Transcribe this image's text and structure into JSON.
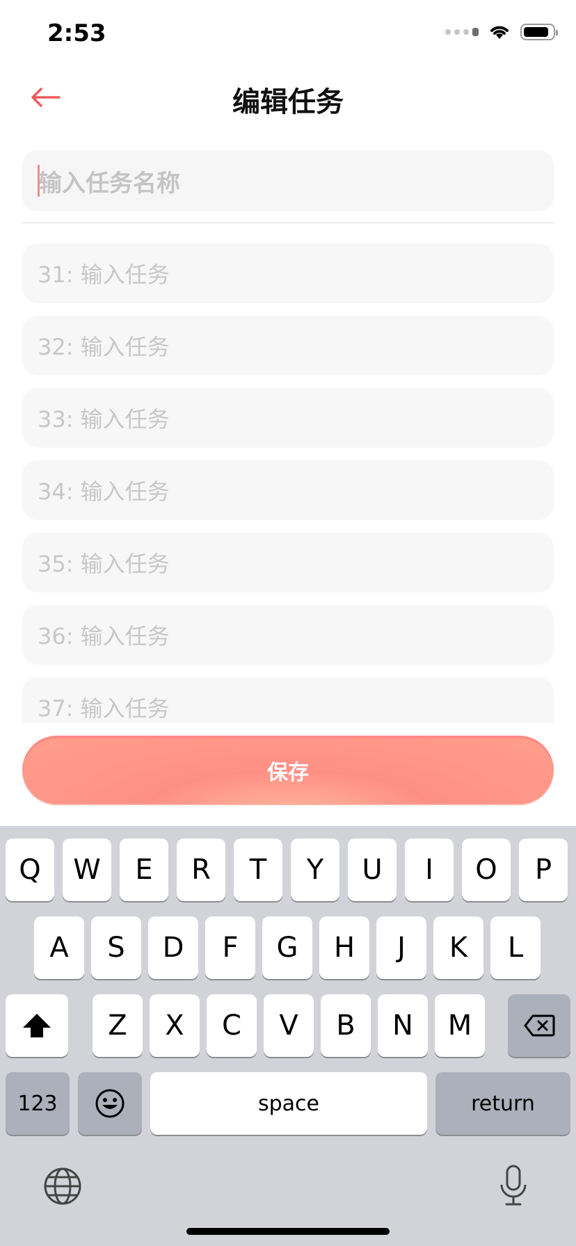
{
  "status": {
    "time": "2:53"
  },
  "nav": {
    "title": "编辑任务"
  },
  "colors": {
    "accent": "#ef5b5b",
    "save_button": "#ff8f86",
    "field_bg": "#f7f7f7",
    "placeholder": "#c7c7c7"
  },
  "name_field": {
    "placeholder": "输入任务名称"
  },
  "tasks": [
    {
      "placeholder": "31: 输入任务"
    },
    {
      "placeholder": "32: 输入任务"
    },
    {
      "placeholder": "33: 输入任务"
    },
    {
      "placeholder": "34: 输入任务"
    },
    {
      "placeholder": "35: 输入任务"
    },
    {
      "placeholder": "36: 输入任务"
    },
    {
      "placeholder": "37: 输入任务"
    }
  ],
  "save_button": {
    "label": "保存"
  },
  "keyboard": {
    "row1": [
      "Q",
      "W",
      "E",
      "R",
      "T",
      "Y",
      "U",
      "I",
      "O",
      "P"
    ],
    "row2": [
      "A",
      "S",
      "D",
      "F",
      "G",
      "H",
      "J",
      "K",
      "L"
    ],
    "row3": [
      "Z",
      "X",
      "C",
      "V",
      "B",
      "N",
      "M"
    ],
    "numbers_label": "123",
    "space_label": "space",
    "return_label": "return"
  },
  "icons": [
    "back-arrow-icon",
    "wifi-icon",
    "battery-icon",
    "signal-icon",
    "shift-icon",
    "backspace-icon",
    "emoji-icon",
    "globe-icon",
    "microphone-icon"
  ]
}
